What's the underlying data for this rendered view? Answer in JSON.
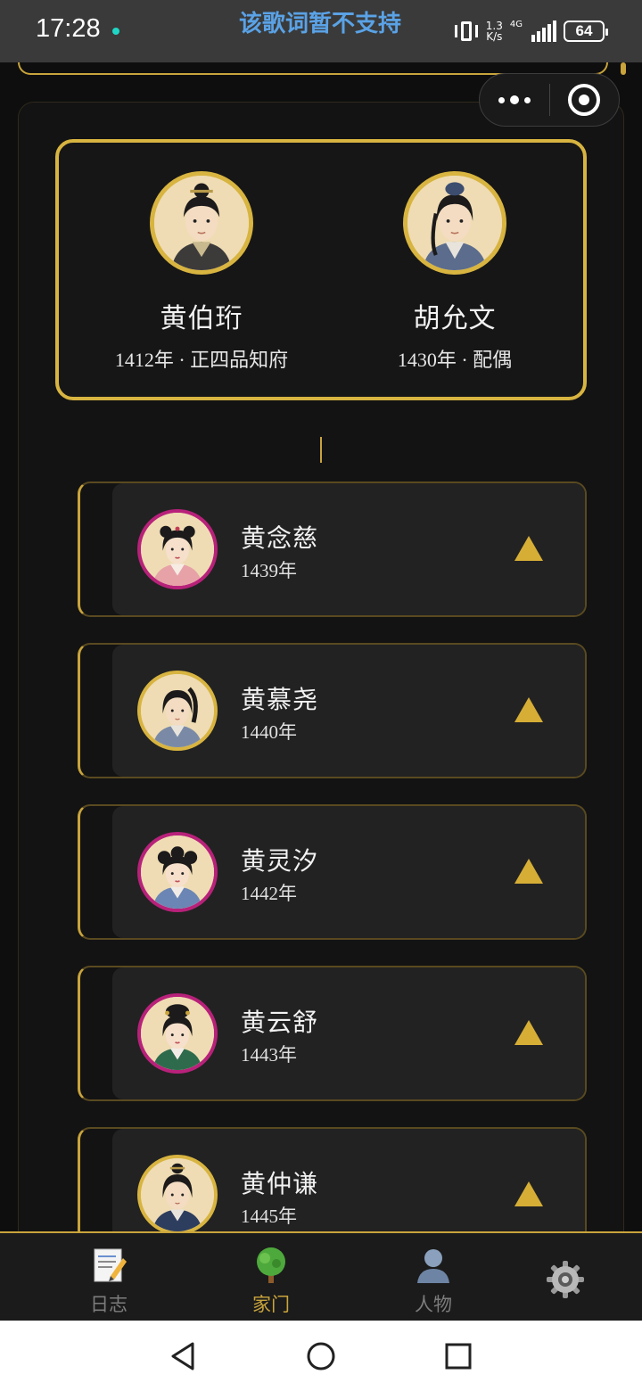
{
  "status_bar": {
    "time": "17:28",
    "ticker": "该歌词暂不支持",
    "net_speed_top": "1.3",
    "net_speed_bottom": "K/s",
    "network": "4G",
    "battery": "64"
  },
  "couple": {
    "head": {
      "name": "黄伯珩",
      "meta": "1412年 · 正四品知府"
    },
    "spouse": {
      "name": "胡允文",
      "meta": "1430年 · 配偶"
    }
  },
  "children": [
    {
      "name": "黄念慈",
      "year": "1439年",
      "frame": "pink"
    },
    {
      "name": "黄慕尧",
      "year": "1440年",
      "frame": "gold"
    },
    {
      "name": "黄灵汐",
      "year": "1442年",
      "frame": "pink"
    },
    {
      "name": "黄云舒",
      "year": "1443年",
      "frame": "pink"
    },
    {
      "name": "黄仲谦",
      "year": "1445年",
      "frame": "gold"
    }
  ],
  "tabs": [
    {
      "label": "日志",
      "icon": "memo-icon",
      "active": false
    },
    {
      "label": "家门",
      "icon": "tree-icon",
      "active": true
    },
    {
      "label": "人物",
      "icon": "person-icon",
      "active": false
    },
    {
      "label": "",
      "icon": "gear-icon",
      "active": false
    }
  ],
  "colors": {
    "accent": "#c9a43c",
    "female_frame": "#b8217a",
    "background": "#0e0e0e"
  }
}
